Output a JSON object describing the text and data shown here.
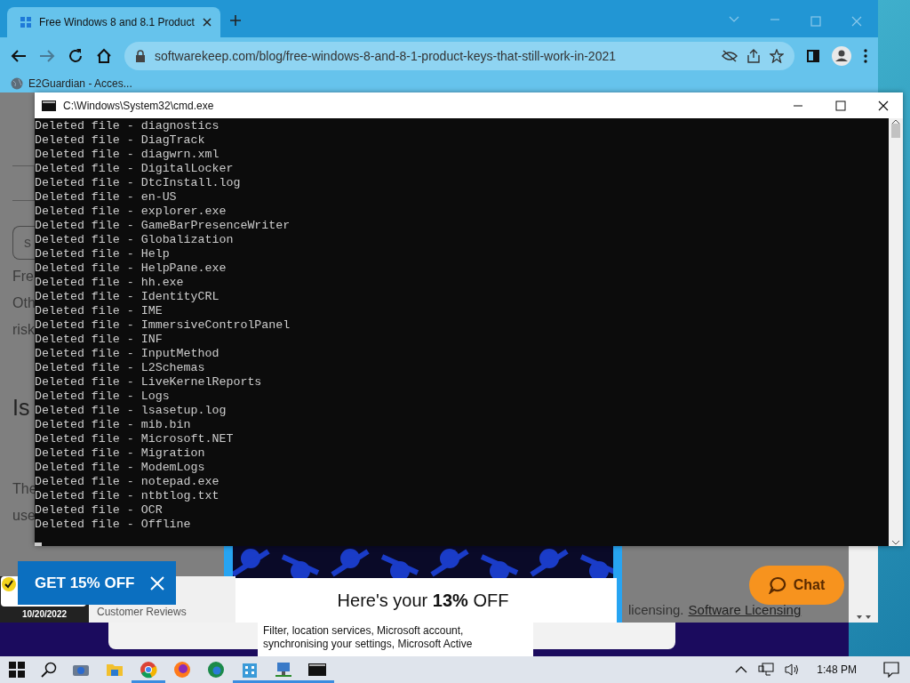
{
  "browser": {
    "tabs": [
      {
        "title": "Free Windows 8 and 8.1 Product",
        "selected": true
      }
    ],
    "url": "softwarekeep.com/blog/free-windows-8-and-8-1-product-keys-that-still-work-in-2021",
    "bookmarks": [
      {
        "label": "E2Guardian - Acces..."
      }
    ],
    "page": {
      "search_button": "s",
      "fragments": [
        "Fre",
        "Oth",
        "risk"
      ],
      "heading": "Is",
      "fragments_2": [
        "The",
        "use"
      ]
    }
  },
  "console": {
    "title": "C:\\Windows\\System32\\cmd.exe",
    "lines": [
      "Deleted file - diagnostics",
      "Deleted file - DiagTrack",
      "Deleted file - diagwrn.xml",
      "Deleted file - DigitalLocker",
      "Deleted file - DtcInstall.log",
      "Deleted file - en-US",
      "Deleted file - explorer.exe",
      "Deleted file - GameBarPresenceWriter",
      "Deleted file - Globalization",
      "Deleted file - Help",
      "Deleted file - HelpPane.exe",
      "Deleted file - hh.exe",
      "Deleted file - IdentityCRL",
      "Deleted file - IME",
      "Deleted file - ImmersiveControlPanel",
      "Deleted file - INF",
      "Deleted file - InputMethod",
      "Deleted file - L2Schemas",
      "Deleted file - LiveKernelReports",
      "Deleted file - Logs",
      "Deleted file - lsasetup.log",
      "Deleted file - mib.bin",
      "Deleted file - Microsoft.NET",
      "Deleted file - Migration",
      "Deleted file - ModemLogs",
      "Deleted file - notepad.exe",
      "Deleted file - ntbtlog.txt",
      "Deleted file - OCR",
      "Deleted file - Offline"
    ]
  },
  "promos": {
    "discount_tab": "GET 15% OFF",
    "badge_date": "10/20/2022",
    "reviews": "Customer Reviews",
    "offer": "Here's your **13%** OFF",
    "footer_text": "licensing.",
    "footer_link": "Software Licensing",
    "chat": "Chat"
  },
  "privacy_lines": [
    "Filter, location services, Microsoft account,",
    "synchronising your settings, Microsoft Active"
  ],
  "taskbar": {
    "apps": [
      {
        "kind": "camera",
        "running": false
      },
      {
        "kind": "folder",
        "running": false
      },
      {
        "kind": "chrome",
        "running": true
      },
      {
        "kind": "firefox",
        "running": false
      },
      {
        "kind": "edge",
        "running": false
      },
      {
        "kind": "building",
        "running": true
      },
      {
        "kind": "network",
        "running": true
      },
      {
        "kind": "console",
        "running": true
      }
    ],
    "clock": "1:48 PM"
  }
}
